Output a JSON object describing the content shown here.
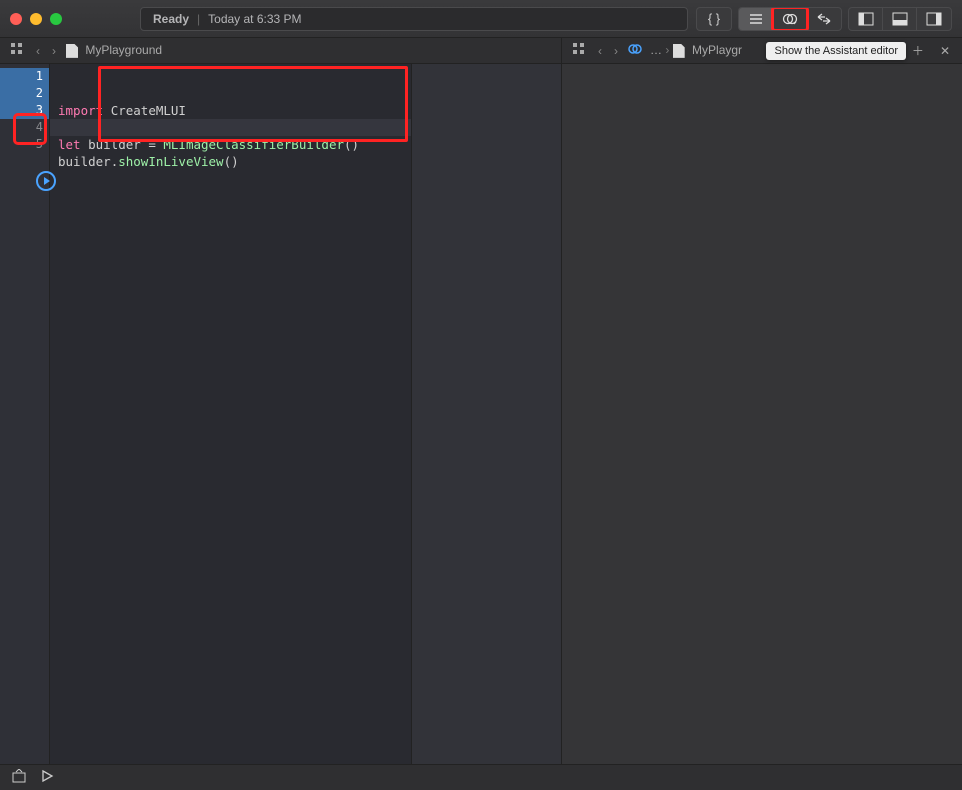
{
  "titlebar": {
    "status_label": "Ready",
    "status_time": "Today at 6:33 PM"
  },
  "tooltip": {
    "assistant": "Show the Assistant editor"
  },
  "breadcrumb": {
    "left_file": "MyPlayground",
    "right_file": "MyPlaygr",
    "ellipsis": "…"
  },
  "gutter": {
    "lines": [
      "1",
      "2",
      "3",
      "4",
      "5"
    ]
  },
  "code": {
    "line1_keyword": "import",
    "line1_module": "CreateMLUI",
    "line3_let": "let",
    "line3_var": "builder",
    "line3_eq": " = ",
    "line3_type": "MLImageClassifierBuilder",
    "line3_parens": "()",
    "line4_var": "builder",
    "line4_dot": ".",
    "line4_method": "showInLiveView",
    "line4_parens": "()"
  }
}
